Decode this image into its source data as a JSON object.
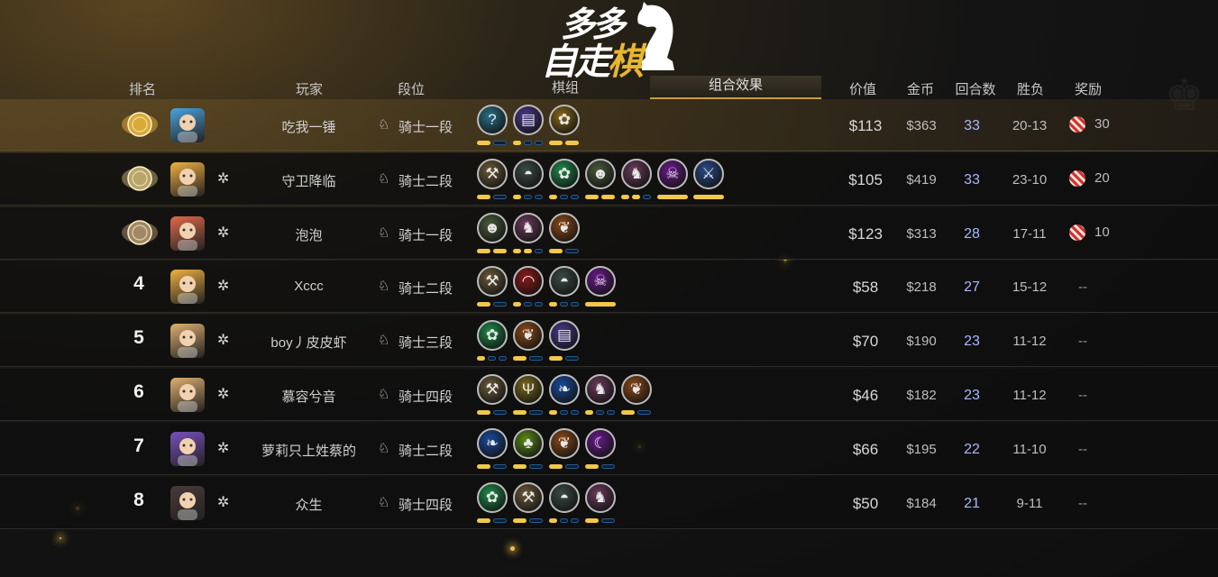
{
  "logo": {
    "line1": "多多",
    "line2a": "自走",
    "line2b": "棋"
  },
  "header": {
    "rank": "排名",
    "player": "玩家",
    "tier": "段位",
    "pieces": "棋组",
    "combo_tab": "组合效果",
    "price": "价值",
    "gold": "金币",
    "rounds": "回合数",
    "wl": "胜负",
    "reward": "奖励"
  },
  "colors": {
    "accent": "#c99b3c",
    "bar_on": "#f2c84b",
    "rounds": "#a9b8ff"
  },
  "rows": [
    {
      "rank": "1",
      "medal": "gold",
      "name": "吃我一锤",
      "tier": "骑士一段",
      "price": "$113",
      "gold": "$363",
      "rounds": "33",
      "wl": "20-13",
      "reward": "30",
      "pieces": [
        {
          "icon": "question-icon",
          "color": "#2a6f86"
        },
        {
          "icon": "book-icon",
          "color": "#4a3a8c"
        },
        {
          "icon": "paw-icon",
          "color": "#8a6a1a"
        }
      ],
      "bars": [
        [
          1,
          0
        ],
        [
          1,
          0,
          0
        ],
        [
          1,
          1
        ]
      ]
    },
    {
      "rank": "2",
      "medal": "silver",
      "name": "守卫降临",
      "tier": "骑士二段",
      "price": "$105",
      "gold": "$419",
      "rounds": "33",
      "wl": "23-10",
      "reward": "20",
      "pieces": [
        {
          "icon": "axe-icon",
          "color": "#6b5a3a"
        },
        {
          "icon": "helmet-icon",
          "color": "#3a4a45"
        },
        {
          "icon": "paw-icon",
          "color": "#1f8a4a"
        },
        {
          "icon": "goblin-icon",
          "color": "#4a5a3a"
        },
        {
          "icon": "horse-icon",
          "color": "#6a3a5a"
        },
        {
          "icon": "demon-icon",
          "color": "#6a1a8a"
        },
        {
          "icon": "sword-icon",
          "color": "#2a4a8a"
        }
      ],
      "bars": [
        [
          1,
          0
        ],
        [
          1,
          0,
          0
        ],
        [
          1,
          0,
          0
        ],
        [
          1,
          1
        ],
        [
          1,
          1,
          0
        ],
        [
          1
        ],
        [
          1
        ]
      ]
    },
    {
      "rank": "3",
      "medal": "bronze",
      "name": "泡泡",
      "tier": "骑士一段",
      "price": "$123",
      "gold": "$313",
      "rounds": "28",
      "wl": "17-11",
      "reward": "10",
      "pieces": [
        {
          "icon": "goblin-icon",
          "color": "#4a5a3a"
        },
        {
          "icon": "horse-icon",
          "color": "#6a3a5a"
        },
        {
          "icon": "leaf-icon",
          "color": "#8a4a1a"
        }
      ],
      "bars": [
        [
          1,
          1
        ],
        [
          1,
          1,
          0
        ],
        [
          1,
          0
        ]
      ]
    },
    {
      "rank": "4",
      "medal": "",
      "name": "Xccc",
      "tier": "骑士二段",
      "price": "$58",
      "gold": "$218",
      "rounds": "27",
      "wl": "15-12",
      "reward": "--",
      "pieces": [
        {
          "icon": "axe-icon",
          "color": "#6b5a3a"
        },
        {
          "icon": "dome-icon",
          "color": "#8a1a1a"
        },
        {
          "icon": "helmet-icon",
          "color": "#3a4a45"
        },
        {
          "icon": "demon-icon",
          "color": "#6a1a8a"
        }
      ],
      "bars": [
        [
          1,
          0
        ],
        [
          1,
          0,
          0
        ],
        [
          1,
          0,
          0
        ],
        [
          1
        ]
      ]
    },
    {
      "rank": "5",
      "medal": "",
      "name": "boy丿皮皮虾",
      "tier": "骑士三段",
      "price": "$70",
      "gold": "$190",
      "rounds": "23",
      "wl": "11-12",
      "reward": "--",
      "pieces": [
        {
          "icon": "paw-icon",
          "color": "#1f8a4a"
        },
        {
          "icon": "leaf-icon",
          "color": "#8a4a1a"
        },
        {
          "icon": "book-icon",
          "color": "#4a3a8c"
        }
      ],
      "bars": [
        [
          1,
          0,
          0
        ],
        [
          1,
          0
        ],
        [
          1,
          0
        ]
      ]
    },
    {
      "rank": "6",
      "medal": "",
      "name": "慕容兮音",
      "tier": "骑士四段",
      "price": "$46",
      "gold": "$182",
      "rounds": "23",
      "wl": "11-12",
      "reward": "--",
      "pieces": [
        {
          "icon": "axe-icon",
          "color": "#6b5a3a"
        },
        {
          "icon": "trident-icon",
          "color": "#7a6a1a"
        },
        {
          "icon": "feather-icon",
          "color": "#1a4a9a"
        },
        {
          "icon": "horse-icon",
          "color": "#6a3a5a"
        },
        {
          "icon": "leaf-icon",
          "color": "#8a4a1a"
        }
      ],
      "bars": [
        [
          1,
          0
        ],
        [
          1,
          0
        ],
        [
          1,
          0,
          0
        ],
        [
          1,
          0,
          0
        ],
        [
          1,
          0
        ]
      ]
    },
    {
      "rank": "7",
      "medal": "",
      "name": "萝莉只上姓蔡的",
      "tier": "骑士二段",
      "price": "$66",
      "gold": "$195",
      "rounds": "22",
      "wl": "11-10",
      "reward": "--",
      "pieces": [
        {
          "icon": "feather-icon",
          "color": "#1a4a9a"
        },
        {
          "icon": "clover-icon",
          "color": "#5a8a1a"
        },
        {
          "icon": "leaf-icon",
          "color": "#8a4a1a"
        },
        {
          "icon": "crescent-icon",
          "color": "#6a1a8a"
        }
      ],
      "bars": [
        [
          1,
          0
        ],
        [
          1,
          0
        ],
        [
          1,
          0
        ],
        [
          1,
          0
        ]
      ]
    },
    {
      "rank": "8",
      "medal": "",
      "name": "众生",
      "tier": "骑士四段",
      "price": "$50",
      "gold": "$184",
      "rounds": "21",
      "wl": "9-11",
      "reward": "--",
      "pieces": [
        {
          "icon": "paw-icon",
          "color": "#1f8a4a"
        },
        {
          "icon": "axe-icon",
          "color": "#6b5a3a"
        },
        {
          "icon": "helmet-icon",
          "color": "#3a4a45"
        },
        {
          "icon": "horse-icon",
          "color": "#6a3a5a"
        }
      ],
      "bars": [
        [
          1,
          0
        ],
        [
          1,
          0
        ],
        [
          1,
          0,
          0
        ],
        [
          1,
          0
        ]
      ]
    }
  ]
}
